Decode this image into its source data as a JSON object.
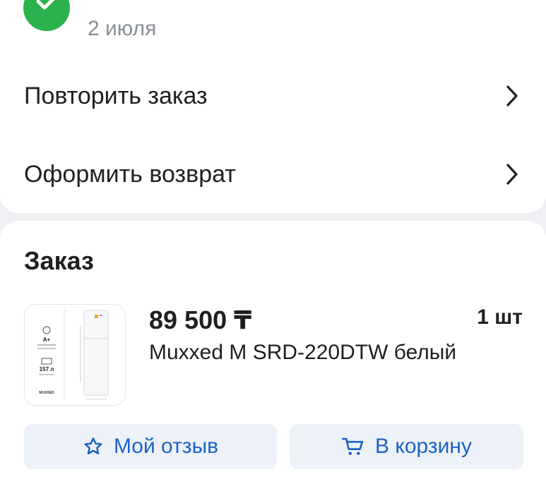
{
  "header": {
    "date": "2 июля",
    "status_color": "#2bb24c"
  },
  "actions": [
    {
      "label": "Повторить заказ",
      "icon": "chevron-right-icon"
    },
    {
      "label": "Оформить возврат",
      "icon": "chevron-right-icon"
    }
  ],
  "order": {
    "title": "Заказ",
    "item": {
      "price": "89 500 ₸",
      "quantity": "1 шт",
      "name": "Muxxed M SRD-220DTW белый",
      "thumb": {
        "energy_class": "A+",
        "volume": "157 л",
        "brand": "MUXXED"
      }
    }
  },
  "buttons": {
    "review_label": "Мой отзыв",
    "review_icon": "star-icon",
    "cart_label": "В корзину",
    "cart_icon": "cart-icon"
  },
  "colors": {
    "accent": "#1c63c4",
    "button_bg": "#edf2f8",
    "page_bg": "#eef0f3"
  }
}
